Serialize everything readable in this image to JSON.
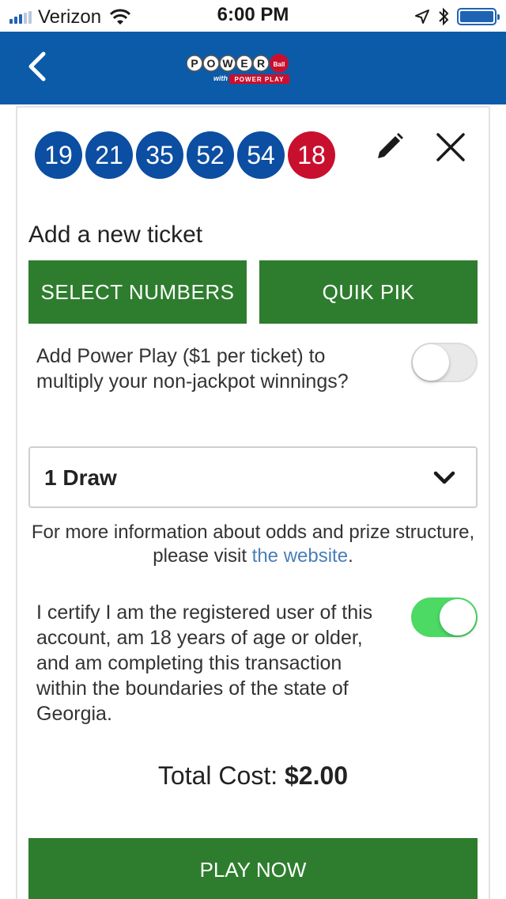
{
  "status_bar": {
    "carrier": "Verizon",
    "time": "6:00 PM"
  },
  "header": {
    "back_icon": "chevron-left-icon",
    "logo_text": "POWERBALL with POWER PLAY",
    "logo_word": "POWER",
    "logo_ball_word": "Ball",
    "logo_with": "with",
    "logo_pp": "POWER PLAY"
  },
  "ticket": {
    "white_balls": [
      "19",
      "21",
      "35",
      "52",
      "54"
    ],
    "powerball": "18",
    "edit_icon": "pencil-icon",
    "close_icon": "close-icon"
  },
  "add_ticket": {
    "title": "Add a new ticket",
    "select_numbers_label": "SELECT NUMBERS",
    "quik_pik_label": "QUIK PIK"
  },
  "power_play": {
    "text": "Add Power Play ($1 per ticket) to multiply your non-jackpot winnings?",
    "enabled": false
  },
  "draws": {
    "selected": "1 Draw",
    "icon": "chevron-down-icon"
  },
  "info": {
    "text_before": "For more information about odds and prize structure, please visit ",
    "link_text": "the website",
    "text_after": "."
  },
  "certify": {
    "text": "I certify I am the registered user of this account, am 18 years of age or older, and am completing this transaction within the boundaries of the state of Georgia.",
    "enabled": true
  },
  "total": {
    "label": "Total Cost:",
    "amount": "$2.00"
  },
  "play_button": {
    "label": "PLAY NOW"
  },
  "colors": {
    "header_blue": "#0c5ba8",
    "ball_blue": "#0b4ea2",
    "powerball_red": "#c8102e",
    "button_green": "#2e7d2e",
    "toggle_on_green": "#4cd964",
    "link_blue": "#4a7eb8"
  }
}
